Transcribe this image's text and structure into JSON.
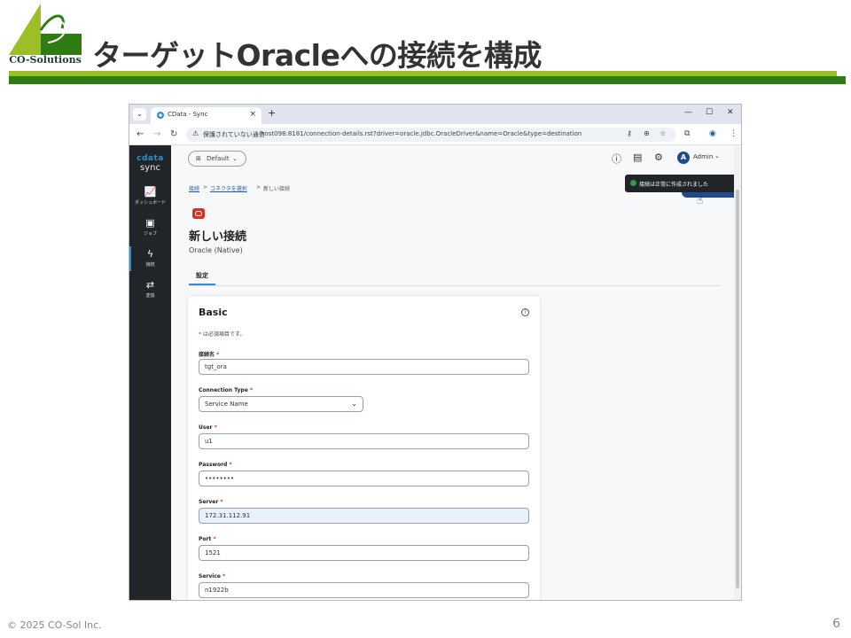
{
  "slide": {
    "logo_text": "CO-Solutions",
    "title": "ターゲットOracleへの接続を構成",
    "footer_copyright": "© 2025 CO-Sol Inc.",
    "page_number": "6",
    "colors": {
      "bar_light": "#9bbf24",
      "bar_dark": "#2f7d12"
    }
  },
  "browser": {
    "tab_title": "CData - Sync",
    "tab_close": "×",
    "new_tab": "+",
    "security_label": "保護されていない通信",
    "url": "host098:8181/connection-details.rst?driver=oracle.jdbc.OracleDriver&name=Oracle&type=destination"
  },
  "app": {
    "brand_top": "cdata",
    "brand_sub": "sync",
    "sidebar": [
      {
        "label": "ダッシュボード",
        "icon": "chart-icon"
      },
      {
        "label": "ジョブ",
        "icon": "briefcase-icon"
      },
      {
        "label": "接続",
        "icon": "bolt-icon",
        "active": true
      },
      {
        "label": "変換",
        "icon": "transfer-icon"
      }
    ],
    "workspace": "Default",
    "user_initial": "A",
    "user_name": "Admin",
    "breadcrumb": {
      "item1": "接続",
      "item2": "コネクタを選択",
      "item3": "新しい接続",
      "sep": ">"
    },
    "page_title": "新しい接続",
    "page_subtitle": "Oracle (Native)",
    "tab_label": "設定",
    "card": {
      "title": "Basic",
      "required_note": "は必須項目です。",
      "fields": {
        "connection_name": {
          "label": "接続名",
          "value": "tgt_ora"
        },
        "connection_type": {
          "label": "Connection Type",
          "value": "Service Name"
        },
        "user": {
          "label": "User",
          "value": "u1"
        },
        "password": {
          "label": "Password",
          "value": "••••••••"
        },
        "server": {
          "label": "Server",
          "value": "172.31.112.91"
        },
        "port": {
          "label": "Port",
          "value": "1521"
        },
        "service": {
          "label": "Service",
          "value": "n1922b"
        }
      }
    },
    "toast": {
      "message": "接続は正常に作成されました",
      "close": "✕"
    },
    "colors": {
      "sidebar": "#212529",
      "accent": "#2a8fd8",
      "oracle": "#d93025",
      "success": "#2e9a4a"
    }
  }
}
